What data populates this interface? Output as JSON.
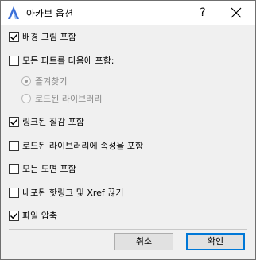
{
  "window": {
    "title": "아카브 옵션",
    "help_label": "?"
  },
  "options": {
    "background": {
      "label": "배경 그림 포함",
      "checked": true
    },
    "all_parts": {
      "label": "모든 파트를 다음에 포함:",
      "checked": false
    },
    "favorites": {
      "label": "즐겨찾기",
      "selected": true,
      "enabled": false
    },
    "loaded_libraries": {
      "label": "로드된 라이브러리",
      "selected": false,
      "enabled": false
    },
    "linked_materials": {
      "label": "링크된 질감 포함",
      "checked": true
    },
    "library_attributes": {
      "label": "로드된 라이브러리에 속성을 포함",
      "checked": false
    },
    "all_drawings": {
      "label": "모든 도면 포함",
      "checked": false
    },
    "break_links": {
      "label": "내포된 핫링크 및 Xref 끊기",
      "checked": false
    },
    "compress": {
      "label": "파일 압축",
      "checked": true
    }
  },
  "buttons": {
    "cancel": "취소",
    "ok": "확인"
  }
}
